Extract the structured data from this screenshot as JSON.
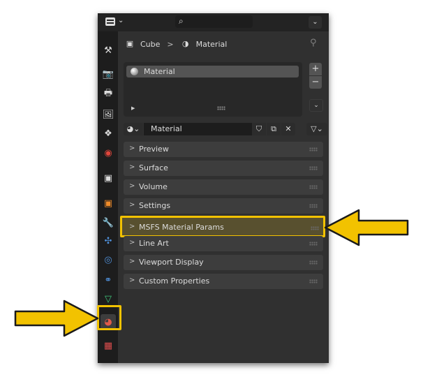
{
  "window": {
    "search": {
      "placeholder": ""
    },
    "editor_type_icon": "editor-type-icon",
    "search_icon": "search-icon"
  },
  "tabs": [
    {
      "name": "tool",
      "icon": "tool-icon",
      "glyph": "⚒",
      "color": "#dcdcdc",
      "active": false
    },
    {
      "name": "render",
      "icon": "render-icon",
      "glyph": "📷",
      "color": "#dcdcdc",
      "active": false
    },
    {
      "name": "output",
      "icon": "output-icon",
      "glyph": "🖶",
      "color": "#dcdcdc",
      "active": false
    },
    {
      "name": "view-layer",
      "icon": "view-layer-icon",
      "glyph": "🖼",
      "color": "#dcdcdc",
      "active": false
    },
    {
      "name": "scene",
      "icon": "scene-icon",
      "glyph": "❖",
      "color": "#dcdcdc",
      "active": false
    },
    {
      "name": "world",
      "icon": "world-icon",
      "glyph": "◉",
      "color": "#e0463c",
      "active": false
    },
    {
      "name": "collection",
      "icon": "collection-icon",
      "glyph": "▣",
      "color": "#dcdcdc",
      "active": false
    },
    {
      "name": "object",
      "icon": "object-icon",
      "glyph": "▣",
      "color": "#f08c2a",
      "active": false
    },
    {
      "name": "modifiers",
      "icon": "wrench-icon",
      "glyph": "🔧",
      "color": "#4f8fd8",
      "active": false
    },
    {
      "name": "particles",
      "icon": "particles-icon",
      "glyph": "✣",
      "color": "#4f8fd8",
      "active": false
    },
    {
      "name": "physics",
      "icon": "physics-icon",
      "glyph": "◎",
      "color": "#4f8fd8",
      "active": false
    },
    {
      "name": "constraints",
      "icon": "constraints-icon",
      "glyph": "⚭",
      "color": "#4f8fd8",
      "active": false
    },
    {
      "name": "data",
      "icon": "mesh-data-icon",
      "glyph": "▽",
      "color": "#3fc57a",
      "active": false
    },
    {
      "name": "material",
      "icon": "material-icon",
      "glyph": "◕",
      "color": "#e05a4a",
      "active": true
    },
    {
      "name": "texture",
      "icon": "texture-icon",
      "glyph": "▦",
      "color": "#d94c4c",
      "active": false
    }
  ],
  "breadcrumb": {
    "object_icon": "object-square-icon",
    "object": "Cube",
    "separator": ">",
    "material_icon": "material-sphere-icon",
    "material": "Material",
    "pin_icon": "pin-icon"
  },
  "material_slots": [
    {
      "name": "Material",
      "selected": true
    }
  ],
  "slot_buttons": {
    "add": "+",
    "remove": "−",
    "specials": "⌄"
  },
  "datablock": {
    "browse_icon": "material-browse-icon",
    "name": "Material",
    "fake_user_icon": "shield-icon",
    "duplicate_icon": "duplicate-icon",
    "unlink_icon": "close-icon",
    "link_icon": "link-mesh-icon"
  },
  "panels": [
    {
      "label": "Preview",
      "highlighted": false
    },
    {
      "label": "Surface",
      "highlighted": false
    },
    {
      "label": "Volume",
      "highlighted": false
    },
    {
      "label": "Settings",
      "highlighted": false
    },
    {
      "label": "MSFS Material Params",
      "highlighted": true
    },
    {
      "label": "Line Art",
      "highlighted": false
    },
    {
      "label": "Viewport Display",
      "highlighted": false
    },
    {
      "label": "Custom Properties",
      "highlighted": false
    }
  ],
  "annotations": {
    "arrow_color": "#f2c200",
    "arrow_outline": "#1a1a1a",
    "highlight_color": "#f2c200"
  }
}
